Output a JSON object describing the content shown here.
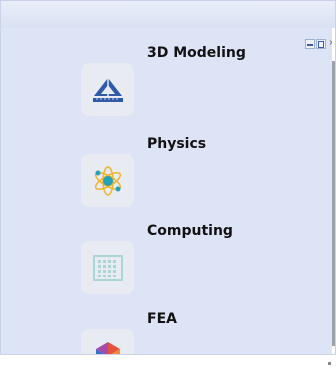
{
  "window": {
    "controls": {
      "minimize": "minimize",
      "maximize": "maximize",
      "close": "×"
    }
  },
  "apps": [
    {
      "label": "3D Modeling",
      "icon": "drafting-triangle-icon"
    },
    {
      "label": "Physics",
      "icon": "atom-icon"
    },
    {
      "label": "Computing",
      "icon": "chip-grid-icon"
    },
    {
      "label": "FEA",
      "icon": "hexagon-mesh-icon"
    }
  ]
}
